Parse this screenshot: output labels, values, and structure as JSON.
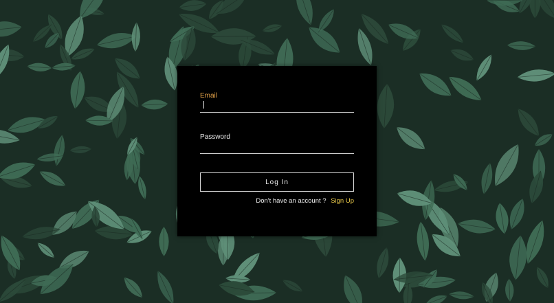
{
  "background": {
    "description_icon": "leaf-pattern",
    "colors": {
      "base": "#1b2e25",
      "leaf_dark": "#2c4a3a",
      "leaf_mid": "#3f6b55",
      "leaf_light": "#5f8f78",
      "vein": "#1a2a22"
    }
  },
  "login_form": {
    "email_label": "Email",
    "email_value": "",
    "password_label": "Password",
    "password_value": "",
    "login_button_label": "Log In",
    "signup_prompt": "Don't have an account ?",
    "signup_link_label": "Sign Up"
  },
  "colors": {
    "card_bg": "#000000",
    "email_label": "#e6a44a",
    "signup_link": "#e8c84a",
    "text": "#f0f0f0"
  }
}
